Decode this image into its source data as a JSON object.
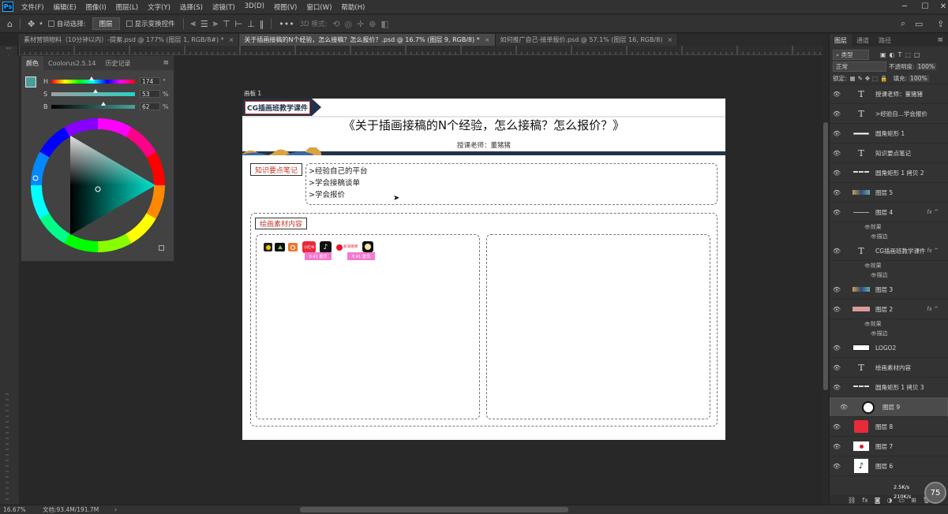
{
  "app": {
    "logo": "Ps"
  },
  "menubar": {
    "items": [
      "文件(F)",
      "编辑(E)",
      "图像(I)",
      "图层(L)",
      "文字(Y)",
      "选择(S)",
      "滤镜(T)",
      "3D(D)",
      "视图(V)",
      "窗口(W)",
      "帮助(H)"
    ]
  },
  "options": {
    "auto_select_label": "自动选择:",
    "auto_select_value": "图层",
    "show_transform_label": "显示变换控件",
    "mode_3d_label": "3D 模式:"
  },
  "tabs": [
    {
      "label": "素材营销物料（10分钟以内）-提案.psd @ 177% (图层 1, RGB/8#) *",
      "active": false
    },
    {
      "label": "关于插画接稿的N个经验，怎么接稿？怎么报价？.psd @ 16.7% (图层 9, RGB/8) *",
      "active": true
    },
    {
      "label": "如何推广自己-接单报价.psd @ 57.1% (图层 16, RGB/8)",
      "active": false
    }
  ],
  "color_panel": {
    "tabs": [
      "颜色",
      "Coolorus2.5.14",
      "历史记录"
    ],
    "h": {
      "label": "H",
      "value": "174",
      "unit": "°",
      "fraction": 0.48
    },
    "s": {
      "label": "S",
      "value": "53",
      "unit": "%",
      "fraction": 0.53
    },
    "b": {
      "label": "B",
      "value": "62",
      "unit": "%",
      "fraction": 0.62
    },
    "foreground": "#4a9e98"
  },
  "artboard": {
    "label": "画板 1",
    "banner_label": "CG插画班教学课件",
    "title": "《关于插画接稿的N个经验，怎么接稿？怎么报价？》",
    "teacher": "授课老师：董猪猪",
    "notes_title": "知识要点笔记",
    "notes": [
      ">经验自己的平台",
      ">学会接稿谈单",
      ">学会报价"
    ],
    "materials_title": "绘画素材内容",
    "platform_icons": [
      "icon-1",
      "icon-2",
      "icon-3",
      "xiaohongshu",
      "douyin",
      "weibo",
      "icon-7"
    ],
    "platform_xhs_text": "小红书",
    "weibo_text": "新浪微博",
    "badges": [
      "0.41 置顶",
      "0.41 置顶"
    ],
    "accent_color": "#c0392b",
    "navy_color": "#1f3350"
  },
  "layers_panel": {
    "tabs": [
      "图层",
      "通道",
      "路径"
    ],
    "filter_kind": "类型",
    "blend_mode": "正常",
    "opacity_label": "不透明度:",
    "opacity_value": "100%",
    "lock_label": "锁定:",
    "fill_label": "填充:",
    "fill_value": "100%",
    "layers": [
      {
        "name": "授课老师：董猪猪",
        "thumb": "T",
        "fx": false,
        "subs": []
      },
      {
        "name": ">经验自...学会报价",
        "thumb": "T",
        "fx": false,
        "subs": []
      },
      {
        "name": "圆角矩形 1",
        "thumb": "rect",
        "fx": false,
        "subs": []
      },
      {
        "name": "知识要点笔记",
        "thumb": "T",
        "fx": false,
        "subs": []
      },
      {
        "name": "圆角矩形 1 拷贝 2",
        "thumb": "dash",
        "fx": false,
        "subs": []
      },
      {
        "name": "图层 5",
        "thumb": "art",
        "fx": false,
        "subs": []
      },
      {
        "name": "图层 4",
        "thumb": "line",
        "fx": true,
        "subs": [
          "效果",
          "描边"
        ]
      },
      {
        "name": "CG插画班教学课件",
        "thumb": "T",
        "fx": true,
        "subs": [
          "效果",
          "描边"
        ]
      },
      {
        "name": "图层 3",
        "thumb": "art",
        "fx": false,
        "subs": []
      },
      {
        "name": "图层 2",
        "thumb": "pink",
        "fx": true,
        "subs": [
          "效果",
          "描边"
        ]
      },
      {
        "name": "LOGO2",
        "thumb": "logo",
        "fx": false,
        "subs": []
      },
      {
        "name": "绘画素材内容",
        "thumb": "T",
        "fx": false,
        "subs": []
      },
      {
        "name": "圆角矩形 1 拷贝 3",
        "thumb": "dash",
        "fx": false,
        "subs": []
      },
      {
        "name": "图层 9",
        "thumb": "circle",
        "fx": false,
        "subs": [],
        "selected": true
      },
      {
        "name": "图层 8",
        "thumb": "xhs",
        "fx": false,
        "subs": []
      },
      {
        "name": "图层 7",
        "thumb": "weibo",
        "fx": false,
        "subs": []
      },
      {
        "name": "图层 6",
        "thumb": "tiktok",
        "fx": false,
        "subs": []
      }
    ]
  },
  "netinfo": {
    "up": "2.5K/s",
    "down": "210K/s"
  },
  "zoom_badge": "75",
  "status": {
    "zoom": "16.67%",
    "doc": "文档:93.4M/191.7M"
  }
}
